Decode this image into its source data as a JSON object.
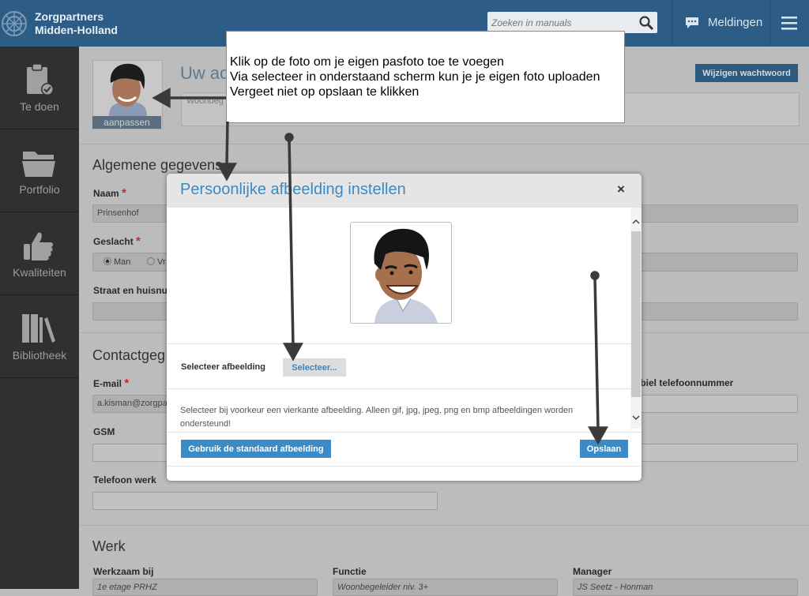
{
  "header": {
    "brand_line1": "Zorgpartners",
    "brand_line2": "Midden-Holland",
    "search_placeholder": "Zoeken in manuals",
    "notifications_label": "Meldingen"
  },
  "sidebar": {
    "items": [
      {
        "label": "Te doen",
        "icon": "clipboard-check-icon"
      },
      {
        "label": "Portfolio",
        "icon": "folder-icon"
      },
      {
        "label": "Kwaliteiten",
        "icon": "thumbs-up-icon"
      },
      {
        "label": "Bibliotheek",
        "icon": "books-icon"
      }
    ]
  },
  "profile": {
    "adjust_label": "aanpassen",
    "title": "Uw ac",
    "change_password_label": "Wijzigen wachtwoord",
    "field_partial": "Woonbeg"
  },
  "general": {
    "heading": "Algemene gegevens",
    "name_label": "Naam",
    "name_value": "Prinsenhof",
    "gender_label": "Geslacht",
    "gender_options": [
      "Man",
      "Vr"
    ],
    "street_label": "Straat en huisnum"
  },
  "contact": {
    "heading": "Contactgeg",
    "email_label": "E-mail",
    "email_value": "a.kisman@zorgpa",
    "gsm_label": "GSM",
    "work_phone_label": "Telefoon werk",
    "mobile_label": "obiel telefoonnummer"
  },
  "work": {
    "heading": "Werk",
    "employer_label": "Werkzaam bij",
    "employer_value": "1e etage PRHZ",
    "function_label": "Functie",
    "function_value": "Woonbegeleider niv. 3+",
    "manager_label": "Manager",
    "manager_value": "JS Seetz - Honman"
  },
  "callout": {
    "line1": "Klik op de foto om je eigen pasfoto toe te voegen",
    "line2": "Via selecteer in onderstaand scherm kun je je eigen foto uploaden",
    "line3": "Vergeet niet op opslaan te klikken"
  },
  "modal": {
    "title": "Persoonlijke afbeelding instellen",
    "close_symbol": "×",
    "select_label": "Selecteer afbeelding",
    "select_button": "Selecteer...",
    "help_text": "Selecteer bij voorkeur een vierkante afbeelding. Alleen gif, jpg, jpeg, png en bmp afbeeldingen worden ondersteund!",
    "default_button": "Gebruik de standaard afbeelding",
    "save_button": "Opslaan"
  },
  "colors": {
    "topbar": "#2d5d86",
    "sidebar": "#303030",
    "accent_blue": "#3b8bc6",
    "required_star": "#b33333"
  }
}
